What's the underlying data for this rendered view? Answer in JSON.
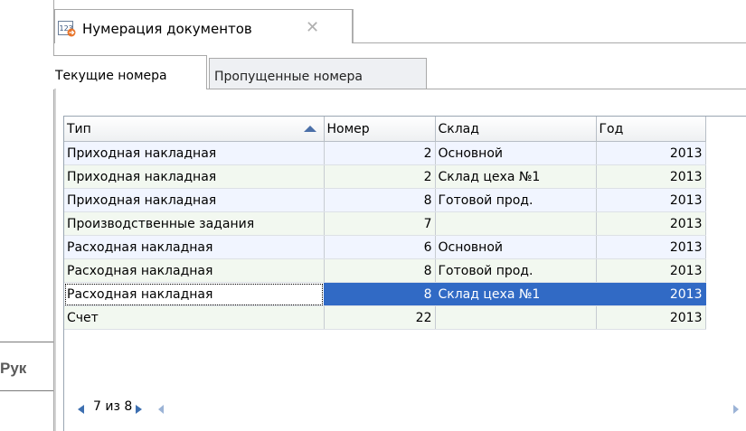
{
  "background": {
    "partial_text": "Рук"
  },
  "document_tab": {
    "title": "Нумерация документов",
    "icon": "numbering-icon",
    "close_glyph": "✕"
  },
  "tabs": [
    {
      "label": "Текущие номера",
      "active": true
    },
    {
      "label": "Пропущенные номера",
      "active": false
    }
  ],
  "grid": {
    "columns": [
      "Тип",
      "Номер",
      "Склад",
      "Год"
    ],
    "sort": {
      "column": "Тип",
      "direction": "asc"
    },
    "rows": [
      {
        "type": "Приходная накладная",
        "number": "2",
        "warehouse": "Основной",
        "year": "2013"
      },
      {
        "type": "Приходная накладная",
        "number": "2",
        "warehouse": "Склад цеха №1",
        "year": "2013"
      },
      {
        "type": "Приходная накладная",
        "number": "8",
        "warehouse": "Готовой прод.",
        "year": "2013"
      },
      {
        "type": "Производственные задания",
        "number": "7",
        "warehouse": "",
        "year": "2013"
      },
      {
        "type": "Расходная накладная",
        "number": "6",
        "warehouse": "Основной",
        "year": "2013"
      },
      {
        "type": "Расходная накладная",
        "number": "8",
        "warehouse": "Готовой прод.",
        "year": "2013"
      },
      {
        "type": "Расходная накладная",
        "number": "8",
        "warehouse": "Склад цеха №1",
        "year": "2013"
      },
      {
        "type": "Счет",
        "number": "22",
        "warehouse": "",
        "year": "2013"
      }
    ],
    "selected_row": 7
  },
  "navigator": {
    "text": "7 из 8"
  },
  "colors": {
    "selection": "#316ac5",
    "row_a": "#f1f5ff",
    "row_b": "#f2f8f0"
  }
}
